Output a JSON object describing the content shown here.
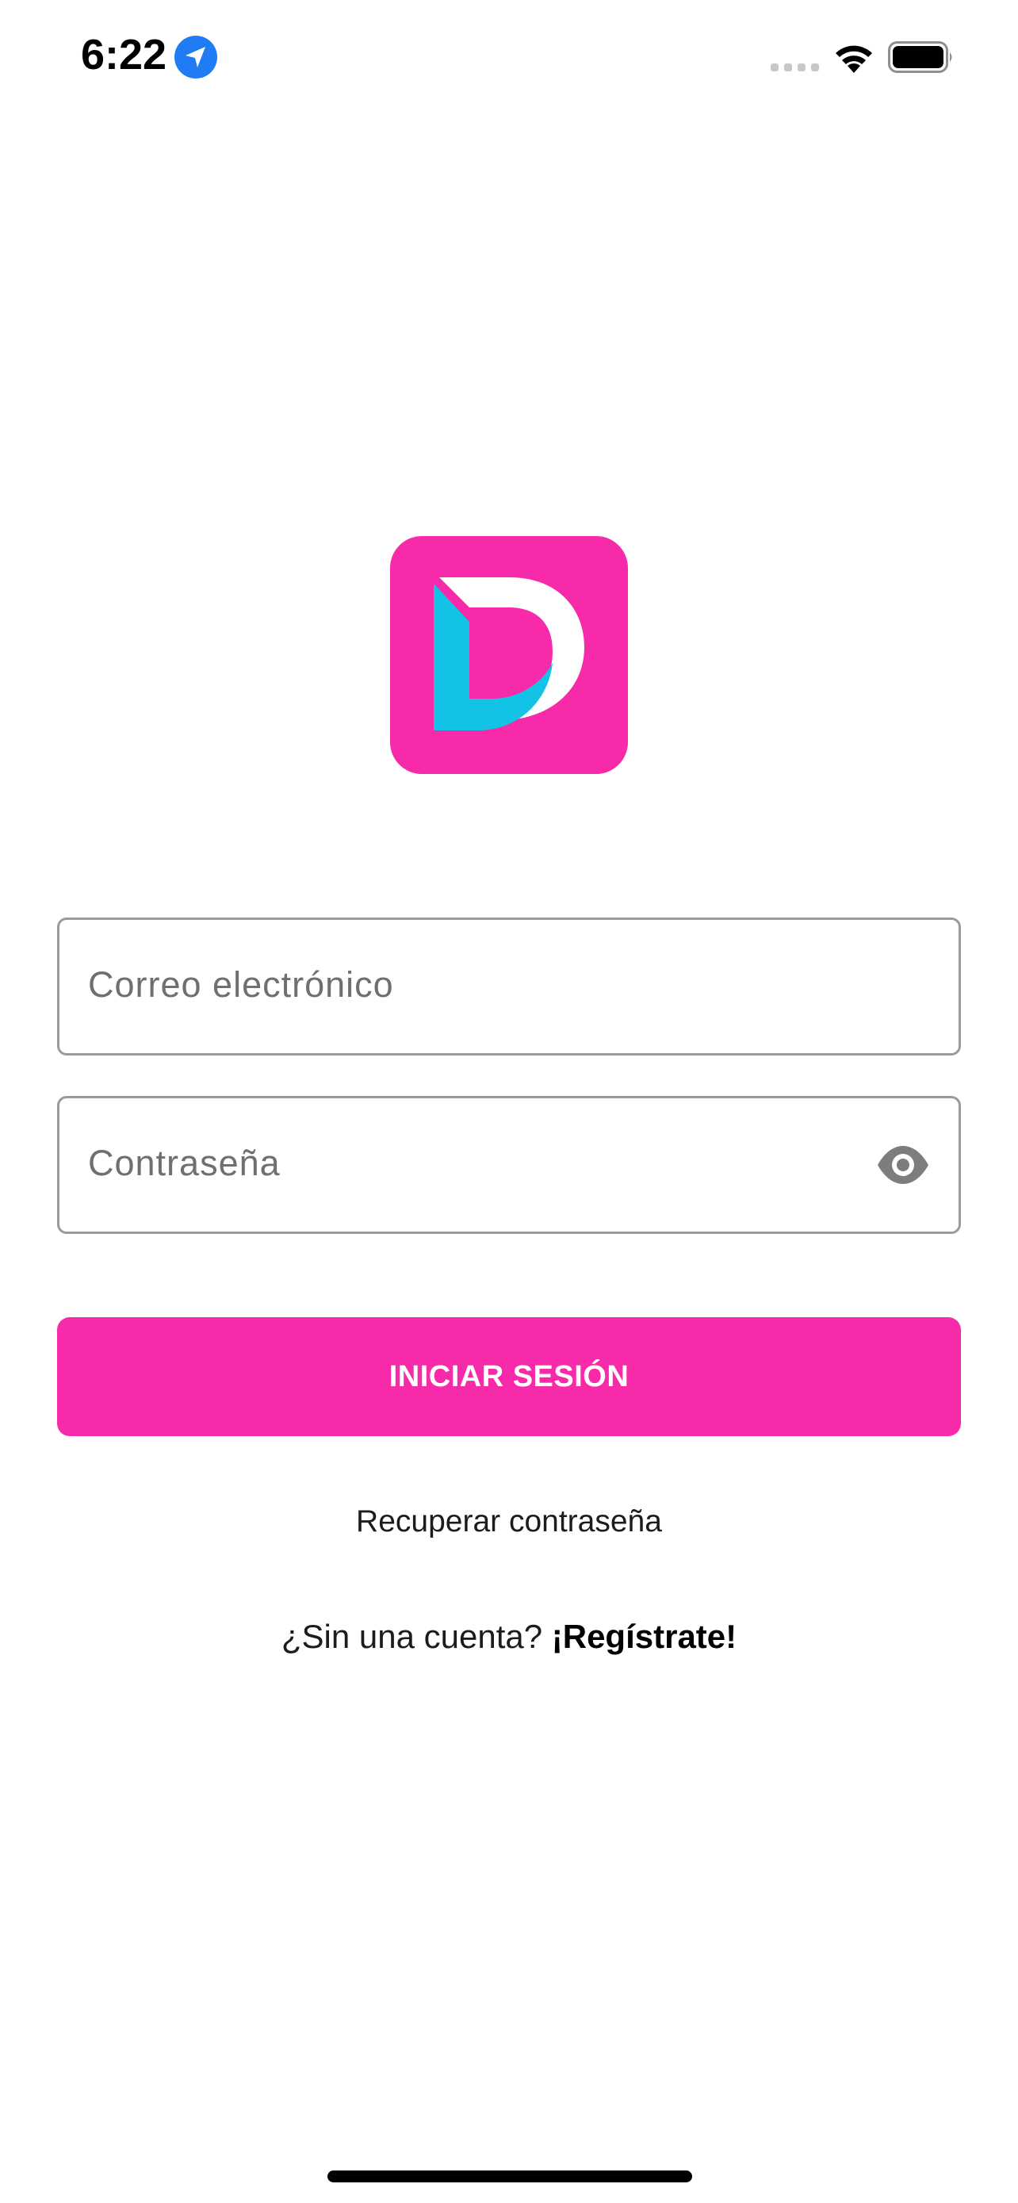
{
  "status_bar": {
    "time": "6:22",
    "icons": [
      "location-icon",
      "signal-icon",
      "wifi-icon",
      "battery-icon"
    ],
    "location_color": "#1f7cf5"
  },
  "logo": {
    "icon": "app-logo",
    "background_color": "#f72aa9",
    "accent_color": "#12c3e6"
  },
  "form": {
    "email_placeholder": "Correo electrónico",
    "password_placeholder": "Contraseña",
    "toggle_visibility_icon": "eye-icon"
  },
  "actions": {
    "login_label": "INICIAR SESIÓN",
    "recover_label": "Recuperar contraseña",
    "signup_prompt": "¿Sin una cuenta?",
    "signup_label": "¡Regístrate!"
  },
  "colors": {
    "brand": "#f72aa9",
    "field_border": "#9a9a9a",
    "placeholder": "#6e6e73"
  }
}
